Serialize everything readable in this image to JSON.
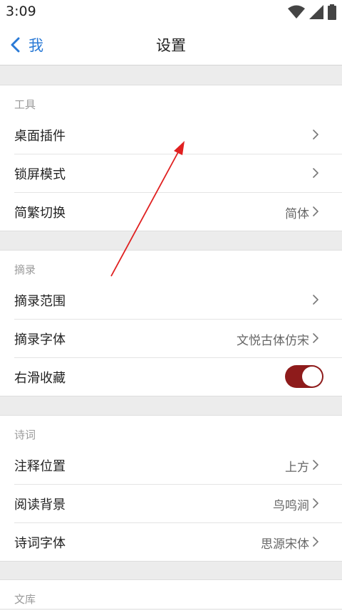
{
  "status": {
    "time": "3:09"
  },
  "navbar": {
    "back_label": "我",
    "title": "设置"
  },
  "sections": [
    {
      "header": "工具",
      "rows": [
        {
          "title": "桌面插件",
          "value": ""
        },
        {
          "title": "锁屏模式",
          "value": ""
        },
        {
          "title": "简繁切换",
          "value": "简体"
        }
      ]
    },
    {
      "header": "摘录",
      "rows": [
        {
          "title": "摘录范围",
          "value": ""
        },
        {
          "title": "摘录字体",
          "value": "文悦古体仿宋"
        },
        {
          "title": "右滑收藏",
          "toggle": true
        }
      ]
    },
    {
      "header": "诗词",
      "rows": [
        {
          "title": "注释位置",
          "value": "上方"
        },
        {
          "title": "阅读背景",
          "value": "鸟鸣涧"
        },
        {
          "title": "诗词字体",
          "value": "思源宋体"
        }
      ]
    },
    {
      "header": "文库",
      "rows": []
    }
  ],
  "colors": {
    "accent": "#2a7ad6",
    "toggle_on": "#8e1b1b",
    "annotation_arrow": "#e02020"
  },
  "icons": {
    "back": "chevron-left-icon",
    "row_arrow": "chevron-right-icon",
    "wifi": "wifi-icon",
    "signal": "signal-icon",
    "battery": "battery-icon"
  }
}
